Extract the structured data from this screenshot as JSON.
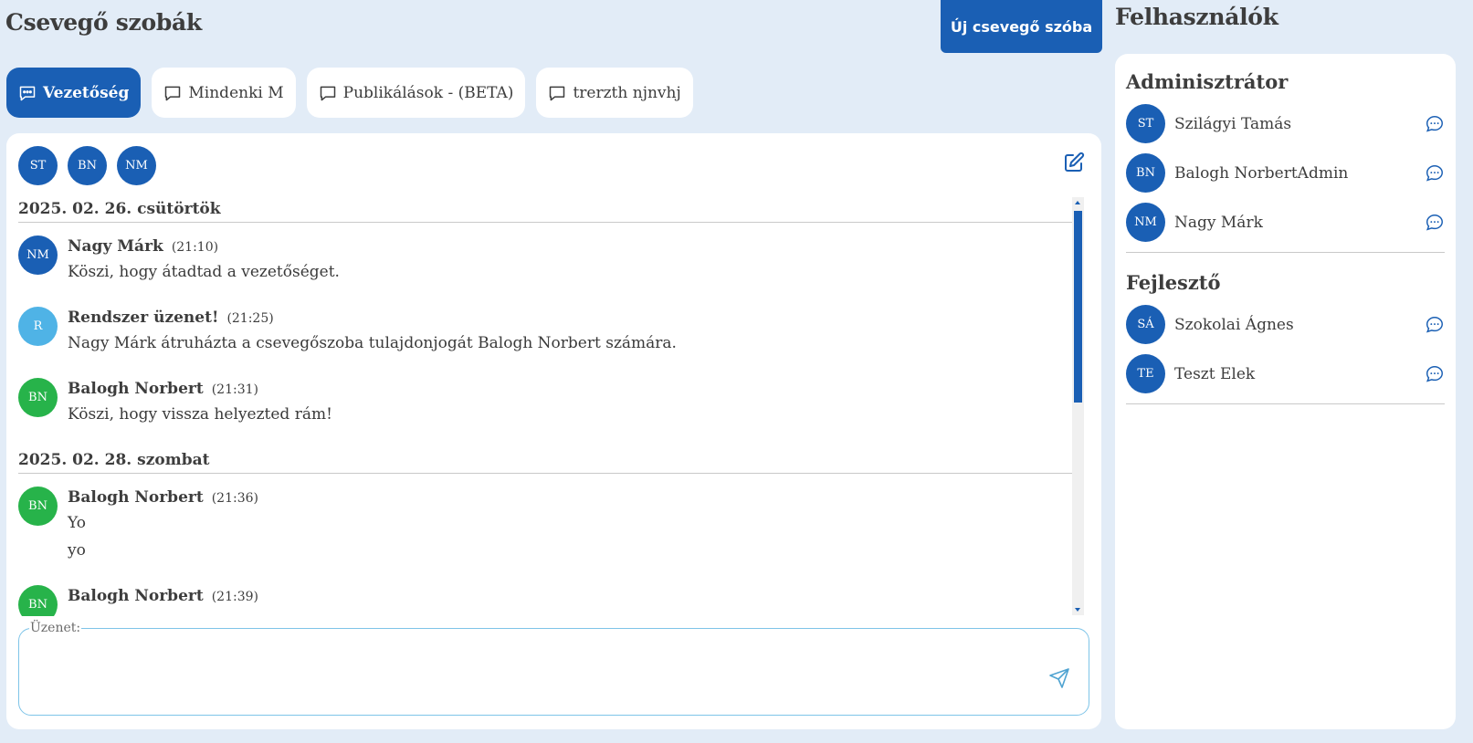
{
  "header": {
    "rooms_title": "Csevegő szobák",
    "new_room_label": "Új csevegő szóba",
    "users_title": "Felhasználók"
  },
  "tabs": [
    {
      "label": "Vezetőség",
      "active": true
    },
    {
      "label": "Mindenki M",
      "active": false
    },
    {
      "label": "Publikálások - (BETA)",
      "active": false
    },
    {
      "label": "trerzth njnvhj",
      "active": false
    }
  ],
  "room": {
    "members": [
      "ST",
      "BN",
      "NM"
    ],
    "days": [
      {
        "date": "2025. 02. 26. csütörtök",
        "messages": [
          {
            "initials": "NM",
            "author": "Nagy Márk",
            "time": "(21:10)",
            "lines": [
              "Köszi, hogy átadtad a vezetőséget."
            ]
          },
          {
            "initials": "R",
            "author": "Rendszer üzenet!",
            "time": "(21:25)",
            "lines": [
              "Nagy Márk átruházta a csevegőszoba tulajdonjogát Balogh Norbert számára."
            ]
          },
          {
            "initials": "BN",
            "author": "Balogh Norbert",
            "time": "(21:31)",
            "lines": [
              "Köszi, hogy vissza helyezted rám!"
            ]
          }
        ]
      },
      {
        "date": "2025. 02. 28. szombat",
        "messages": [
          {
            "initials": "BN",
            "author": "Balogh Norbert",
            "time": "(21:36)",
            "lines": [
              "Yo",
              "yo"
            ]
          },
          {
            "initials": "BN",
            "author": "Balogh Norbert",
            "time": "(21:39)",
            "lines": []
          }
        ]
      }
    ]
  },
  "composer": {
    "legend": "Üzenet:",
    "value": ""
  },
  "user_groups": [
    {
      "title": "Adminisztrátor",
      "users": [
        {
          "initials": "ST",
          "name": "Szilágyi Tamás"
        },
        {
          "initials": "BN",
          "name": "Balogh NorbertAdmin"
        },
        {
          "initials": "NM",
          "name": "Nagy Márk"
        }
      ]
    },
    {
      "title": "Fejlesztő",
      "users": [
        {
          "initials": "SÁ",
          "name": "Szokolai Ágnes"
        },
        {
          "initials": "TE",
          "name": "Teszt Elek"
        }
      ]
    }
  ],
  "colors": {
    "accent": "#1a5fb4",
    "system_avatar": "#4fb3e6",
    "own_avatar": "#27b34a",
    "background": "#e2ecf7"
  },
  "scroll_position": 0.0
}
